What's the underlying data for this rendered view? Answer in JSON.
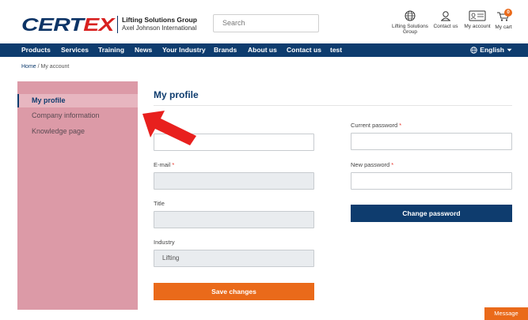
{
  "header": {
    "logo_word_a": "CERT",
    "logo_word_b": "EX",
    "logo_line1": "Lifting Solutions Group",
    "logo_line2": "Axel Johnson International",
    "search_placeholder": "Search",
    "icons": [
      {
        "name": "globe-icon",
        "label": "Lifting Solutions Group"
      },
      {
        "name": "contact-icon",
        "label": "Contact us"
      },
      {
        "name": "account-icon",
        "label": "My account"
      },
      {
        "name": "cart-icon",
        "label": "My cart",
        "badge": "0"
      }
    ]
  },
  "nav": {
    "items": [
      "Products",
      "Services",
      "Training",
      "News",
      "Your Industry",
      "Brands",
      "About us",
      "Contact us",
      "test"
    ],
    "language": "English"
  },
  "breadcrumb": {
    "home": "Home",
    "separator": " / ",
    "current": "My account"
  },
  "sidebar": {
    "items": [
      "My profile",
      "Company information",
      "Knowledge page"
    ],
    "active": "My profile"
  },
  "main": {
    "title": "My profile",
    "left": {
      "name_label": "",
      "email_label": "E-mail",
      "title_label": "Title",
      "industry_label": "Industry",
      "industry_value": "Lifting",
      "save_label": "Save changes"
    },
    "right": {
      "current_password_label": "Current password",
      "new_password_label": "New password",
      "change_label": "Change password"
    },
    "required_mark": "*"
  },
  "message_label": "Message",
  "colors": {
    "navy": "#0e3c6e",
    "orange": "#ea6a1a",
    "red": "#e8352b",
    "sidebar_overlay": "#dc9aa7"
  }
}
